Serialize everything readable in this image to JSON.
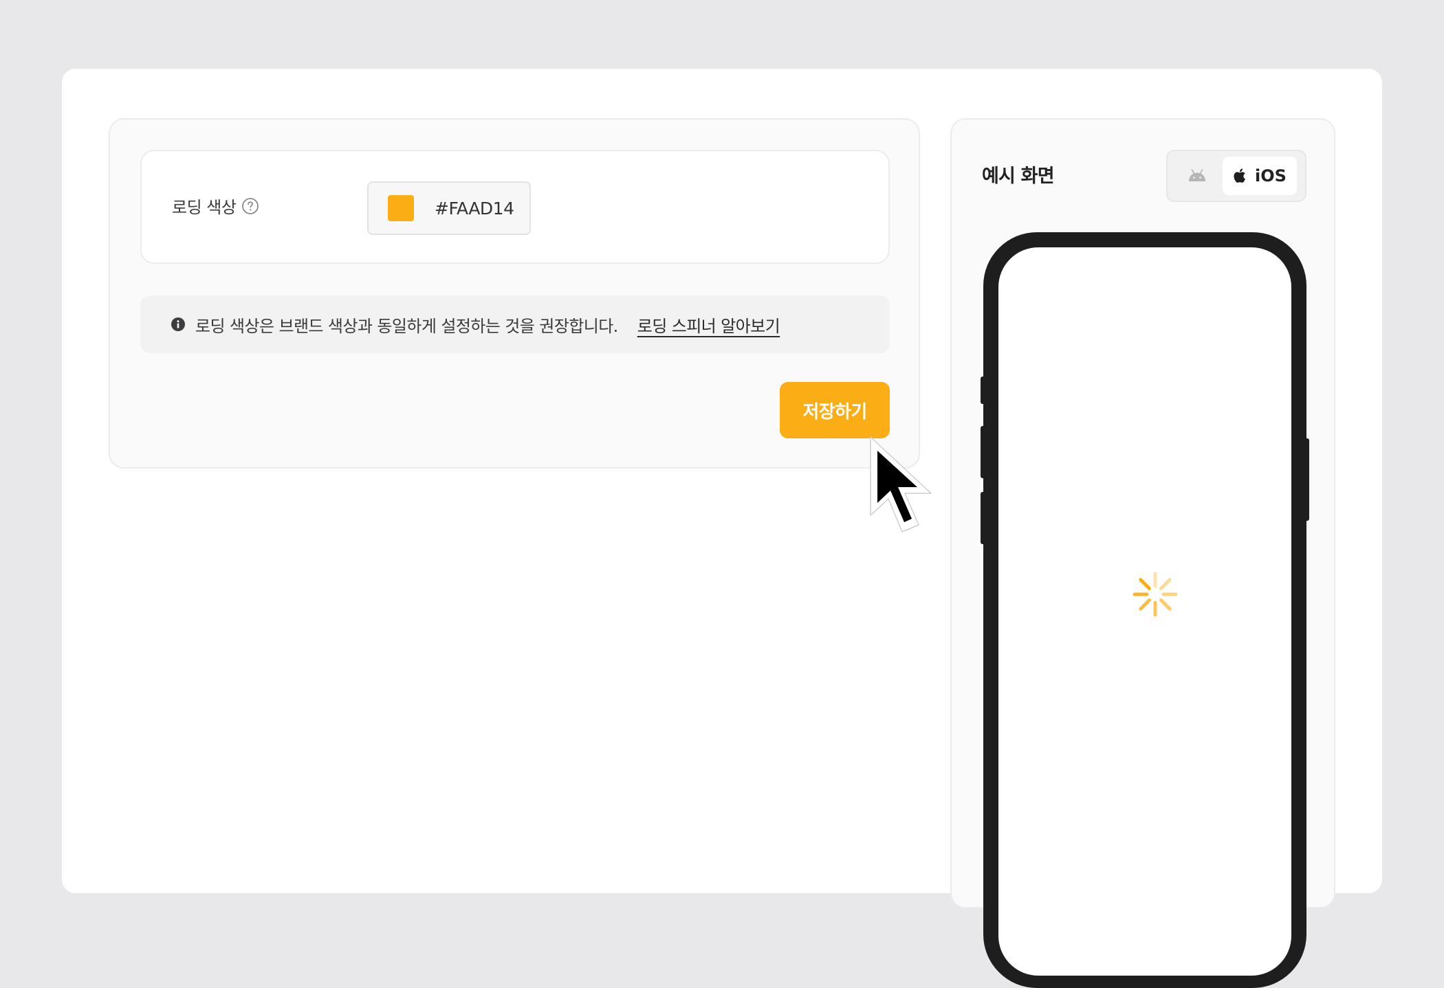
{
  "settings": {
    "loading_color_label": "로딩 색상",
    "color_value": "#FAAD14",
    "color_hex": "#faad14"
  },
  "info": {
    "message": "로딩 색상은 브랜드 색상과 동일하게 설정하는 것을 권장합니다.",
    "link_label": "로딩 스피너 알아보기"
  },
  "save_label": "저장하기",
  "preview": {
    "title": "예시 화면",
    "os_options": [
      {
        "id": "android",
        "label": "",
        "icon": "android-icon",
        "selected": false
      },
      {
        "id": "ios",
        "label": "iOS",
        "icon": "apple-icon",
        "selected": true
      }
    ],
    "spinner_color": "#faad14"
  },
  "icons": {
    "help": "help-circle-icon",
    "info": "info-icon"
  }
}
